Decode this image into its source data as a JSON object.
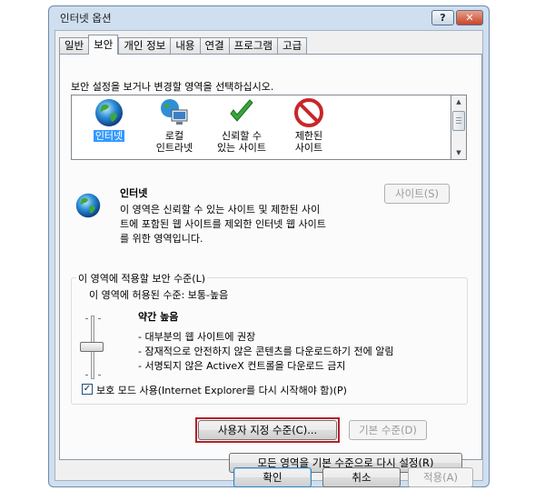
{
  "window": {
    "title": "인터넷 옵션",
    "help_label": "?",
    "close_label": "✕"
  },
  "tabs": [
    {
      "label": "일반"
    },
    {
      "label": "보안"
    },
    {
      "label": "개인 정보"
    },
    {
      "label": "내용"
    },
    {
      "label": "연결"
    },
    {
      "label": "프로그램"
    },
    {
      "label": "고급"
    }
  ],
  "security": {
    "instruction": "보안 설정을 보거나 변경할 영역을 선택하십시오.",
    "zones": [
      {
        "label": "인터넷",
        "icon": "globe-icon",
        "selected": true
      },
      {
        "label": "로컬\n인트라넷",
        "icon": "intranet-icon"
      },
      {
        "label": "신뢰할 수\n있는 사이트",
        "icon": "checkmark-icon"
      },
      {
        "label": "제한된\n사이트",
        "icon": "restricted-icon"
      }
    ],
    "zone_title": "인터넷",
    "zone_desc_1": "이 영역은 신뢰할 수 있는 사이트 및 제한된 사이",
    "zone_desc_2": "트에 포함된 웹 사이트를 제외한 인터넷 웹 사이트",
    "zone_desc_3": "를 위한 영역입니다.",
    "sites_button": "사이트(S)",
    "group_title": "이 영역에 적용할 보안 수준(L)",
    "allowed_levels": "이 영역에 허용된 수준: 보통-높음",
    "level_name": "약간 높음",
    "bullets": [
      "- 대부분의 웹 사이트에 권장",
      "- 잠재적으로 안전하지 않은 콘텐츠를 다운로드하기 전에 알림",
      "- 서명되지 않은 ActiveX 컨트롤을 다운로드 금지"
    ],
    "protected_mode_label": "보호 모드 사용(Internet Explorer를 다시 시작해야 함)(P)",
    "protected_mode_checked": "✓",
    "custom_level_button": "사용자 지정 수준(C)...",
    "default_level_button": "기본 수준(D)",
    "reset_all_button": "모든 영역을 기본 수준으로 다시 설정(R)"
  },
  "footer": {
    "ok": "확인",
    "cancel": "취소",
    "apply": "적용(A)"
  },
  "colors": {
    "highlight": "#b3202a",
    "selection": "#3399ff"
  }
}
